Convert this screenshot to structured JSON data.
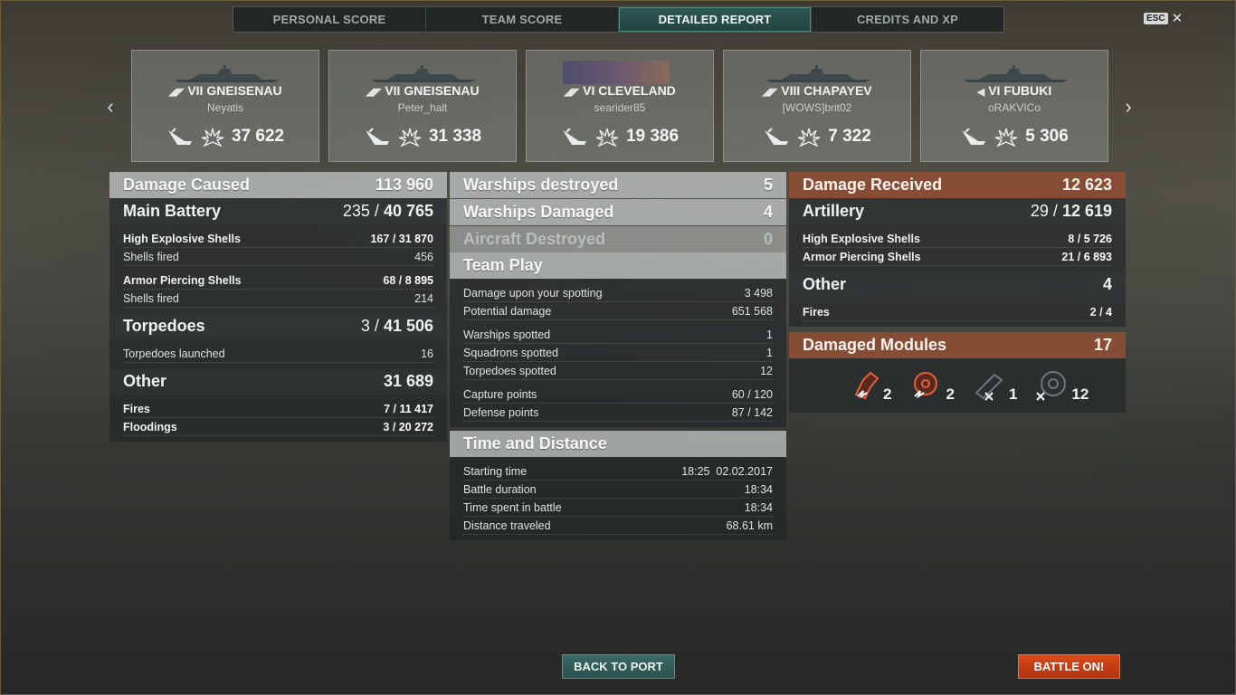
{
  "tabs": [
    "PERSONAL SCORE",
    "TEAM SCORE",
    "DETAILED REPORT",
    "CREDITS AND XP"
  ],
  "esc": {
    "key": "ESC",
    "close": "✕"
  },
  "nav": {
    "prev": "‹",
    "next": "›"
  },
  "cards": [
    {
      "tier": "VII",
      "ship": "GNEISENAU",
      "player": "Neyatis",
      "damage": "37 622"
    },
    {
      "tier": "VII",
      "ship": "GNEISENAU",
      "player": "Peter_halt",
      "damage": "31 338"
    },
    {
      "tier": "VI",
      "ship": "CLEVELAND",
      "player": "searider85",
      "damage": "19 386"
    },
    {
      "tier": "VIII",
      "ship": "CHAPAYEV",
      "player": "[WOWS]brit02",
      "damage": "7 322"
    },
    {
      "tier": "VI",
      "ship": "FUBUKI",
      "player": "oRAKVICo",
      "damage": "5 306"
    }
  ],
  "left": {
    "damage_caused": {
      "label": "Damage Caused",
      "value": "113 960"
    },
    "main_battery": {
      "label": "Main Battery",
      "hits": "235",
      "value": "40 765"
    },
    "he": {
      "label": "High Explosive Shells",
      "hits": "167",
      "value": "31 870"
    },
    "he_fired": {
      "label": "Shells fired",
      "value": "456"
    },
    "ap": {
      "label": "Armor Piercing Shells",
      "hits": "68",
      "value": "8 895"
    },
    "ap_fired": {
      "label": "Shells fired",
      "value": "214"
    },
    "torpedoes": {
      "label": "Torpedoes",
      "hits": "3",
      "value": "41 506"
    },
    "torp_launched": {
      "label": "Torpedoes launched",
      "value": "16"
    },
    "other": {
      "label": "Other",
      "value": "31 689"
    },
    "fires": {
      "label": "Fires",
      "hits": "7",
      "value": "11 417"
    },
    "floodings": {
      "label": "Floodings",
      "hits": "3",
      "value": "20 272"
    }
  },
  "mid": {
    "destroyed": {
      "label": "Warships destroyed",
      "value": "5"
    },
    "damaged": {
      "label": "Warships Damaged",
      "value": "4"
    },
    "aircraft": {
      "label": "Aircraft Destroyed",
      "value": "0"
    },
    "team_play": {
      "label": "Team Play"
    },
    "spotting_dmg": {
      "label": "Damage upon your spotting",
      "value": "3 498"
    },
    "potential": {
      "label": "Potential damage",
      "value": "651 568"
    },
    "ships_spotted": {
      "label": "Warships spotted",
      "value": "1"
    },
    "squadrons": {
      "label": "Squadrons spotted",
      "value": "1"
    },
    "torps_spotted": {
      "label": "Torpedoes spotted",
      "value": "12"
    },
    "capture": {
      "label": "Capture points",
      "value": "60 / 120"
    },
    "defense": {
      "label": "Defense points",
      "value": "87 / 142"
    },
    "time_distance": {
      "label": "Time and Distance"
    },
    "start": {
      "label": "Starting time",
      "value": "18:25  02.02.2017"
    },
    "duration": {
      "label": "Battle duration",
      "value": "18:34"
    },
    "spent": {
      "label": "Time spent in battle",
      "value": "18:34"
    },
    "distance": {
      "label": "Distance traveled",
      "value": "68.61 km"
    }
  },
  "right": {
    "received": {
      "label": "Damage Received",
      "value": "12 623"
    },
    "artillery": {
      "label": "Artillery",
      "hits": "29",
      "value": "12 619"
    },
    "he": {
      "label": "High Explosive Shells",
      "hits": "8",
      "value": "5 726"
    },
    "ap": {
      "label": "Armor Piercing Shells",
      "hits": "21",
      "value": "6 893"
    },
    "other": {
      "label": "Other",
      "value": "4"
    },
    "fires": {
      "label": "Fires",
      "hits": "2",
      "value": "4"
    },
    "modules": {
      "label": "Damaged Modules",
      "value": "17"
    },
    "module_counts": [
      "2",
      "2",
      "1",
      "12"
    ]
  },
  "buttons": {
    "back": "BACK TO PORT",
    "battle": "BATTLE ON!"
  },
  "colors": {
    "accent_teal": "#2a514d",
    "battle_orange": "#c13c13",
    "received_orange": "#8c4e34"
  }
}
